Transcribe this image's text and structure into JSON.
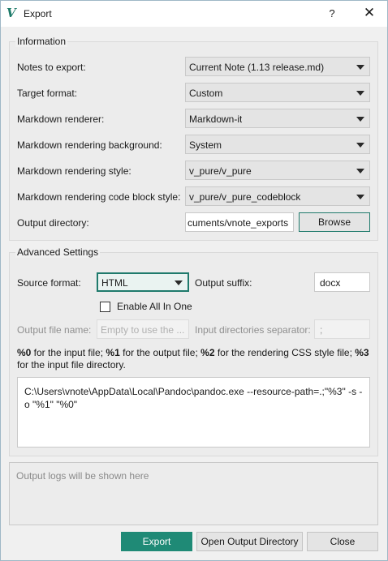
{
  "window": {
    "title": "Export",
    "help_label": "?",
    "close_label": "✕",
    "logo_label": "V"
  },
  "information": {
    "title": "Information",
    "notes_to_export": {
      "label": "Notes to export:",
      "value": "Current Note (1.13 release.md)"
    },
    "target_format": {
      "label": "Target format:",
      "value": "Custom"
    },
    "markdown_renderer": {
      "label": "Markdown renderer:",
      "value": "Markdown-it"
    },
    "rendering_background": {
      "label": "Markdown rendering background:",
      "value": "System"
    },
    "rendering_style": {
      "label": "Markdown rendering style:",
      "value": "v_pure/v_pure"
    },
    "code_block_style": {
      "label": "Markdown rendering code block style:",
      "value": "v_pure/v_pure_codeblock"
    },
    "output_directory": {
      "label": "Output directory:",
      "value": "cuments/vnote_exports",
      "browse_label": "Browse"
    }
  },
  "advanced": {
    "title": "Advanced Settings",
    "source_format": {
      "label": "Source format:",
      "value": "HTML"
    },
    "output_suffix": {
      "label": "Output suffix:",
      "value": "docx"
    },
    "enable_all_in_one": {
      "label": "Enable All In One",
      "checked": false
    },
    "output_file_name": {
      "label": "Output file name:",
      "placeholder": "Empty to use the ..."
    },
    "input_dir_separator": {
      "label": "Input directories separator:",
      "value": ";"
    },
    "help": {
      "t0": "%0",
      "t1": " for the input file; ",
      "t2": "%1",
      "t3": " for the output file; ",
      "t4": "%2",
      "t5": " for the rendering CSS style file; ",
      "t6": "%3",
      "t7": " for the input file directory."
    },
    "command": "C:\\Users\\vnote\\AppData\\Local\\Pandoc\\pandoc.exe  --resource-path=.;\"%3\" -s -o \"%1\" \"%0\""
  },
  "logs": {
    "placeholder": "Output logs will be shown here"
  },
  "footer": {
    "export_label": "Export",
    "open_output_label": "Open Output Directory",
    "close_label": "Close"
  },
  "colors": {
    "accent": "#1f8a76",
    "logo": "#1e7b6a"
  }
}
